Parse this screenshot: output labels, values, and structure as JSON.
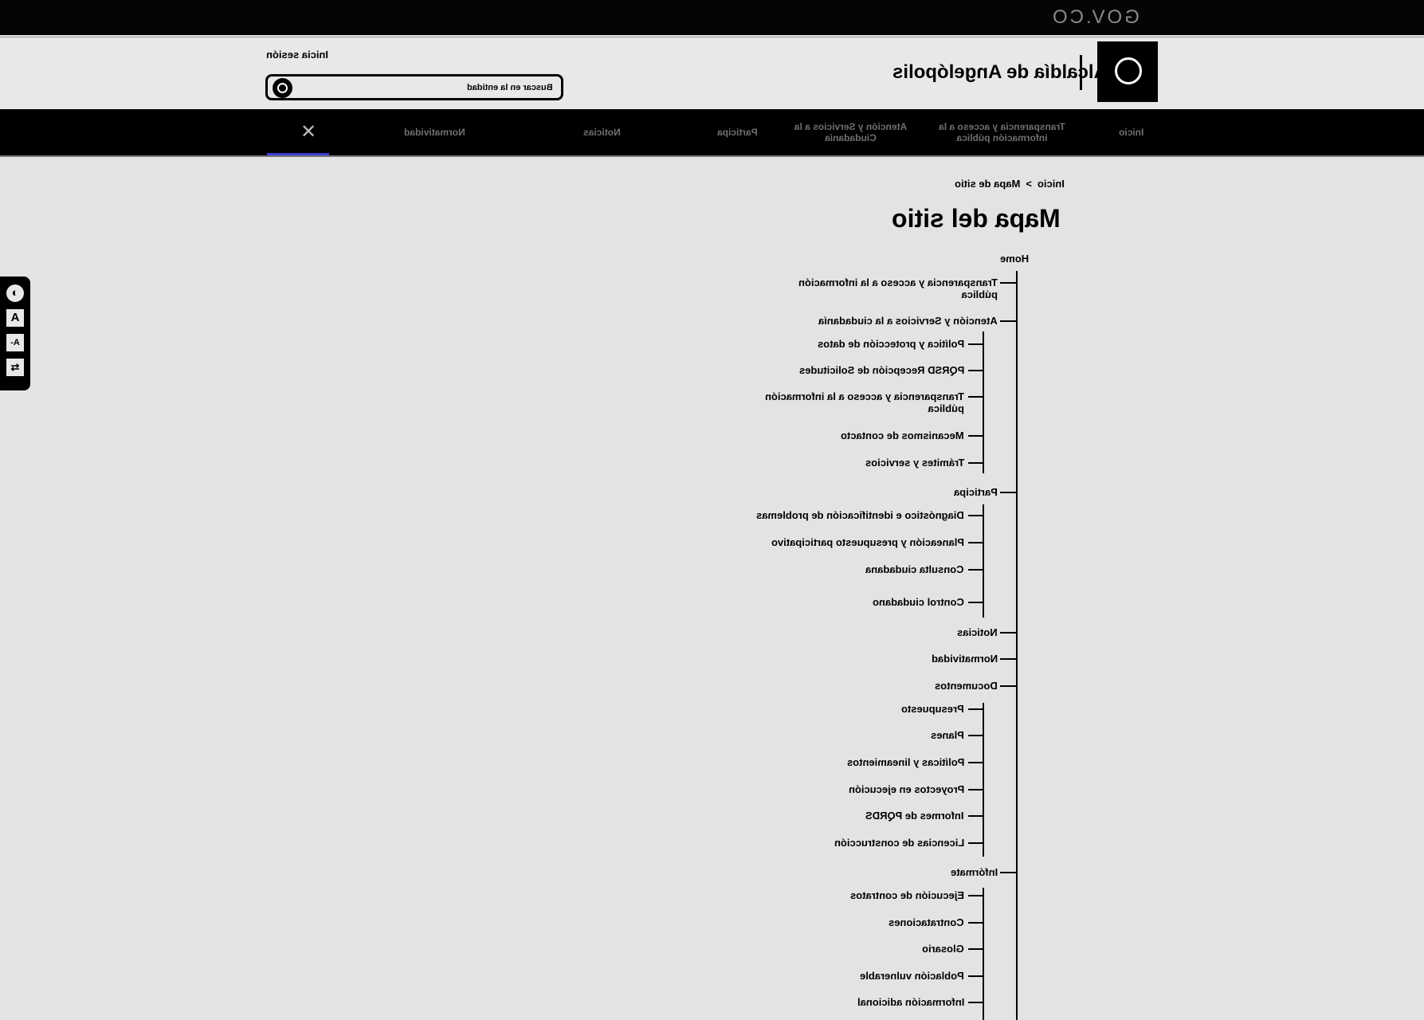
{
  "gov_bar": {
    "logo_text": "GOV.CO"
  },
  "header": {
    "entity_name": "Alcaldía de Angelópolis",
    "login_label": "Inicia sesión",
    "search_placeholder": "Buscar en la entidad"
  },
  "nav": {
    "items": [
      {
        "label": "Inicio"
      },
      {
        "label": "Transparencia y acceso a la información pública"
      },
      {
        "label": "Atención y Servicios a la Ciudadanía"
      },
      {
        "label": "Participa"
      },
      {
        "label": "Noticias"
      },
      {
        "label": "Normatividad"
      }
    ]
  },
  "breadcrumb": {
    "home": "Inicio",
    "separator": ">",
    "current": "Mapa de sitio"
  },
  "page_title": "Mapa del sitio",
  "tree": {
    "root": "Home",
    "sections": [
      {
        "label": "Transparencia y acceso a la información pública",
        "children": []
      },
      {
        "label": "Atención y Servicios a la ciudadanía",
        "children": [
          "Política y protección de datos",
          "PQRSD Recepción de Solicitudes",
          "Transparencia y acceso a la información pública",
          "Mecanismos de contacto",
          "Trámites y servicios"
        ]
      },
      {
        "label": "Participa",
        "children": [
          "Diagnóstico e identificación de problemas",
          "Planeación y presupuesto participativo",
          "Consulta ciudadana",
          "Control ciudadano"
        ]
      },
      {
        "label": "Noticias",
        "children": []
      },
      {
        "label": "Normatividad",
        "children": []
      },
      {
        "label": "Documentos",
        "children": [
          "Presupuesto",
          "Planes",
          "Políticas y lineamientos",
          "Proyectos en ejecución",
          "Informes de PQRDS",
          "Licencias de construcción"
        ]
      },
      {
        "label": "Infórmate",
        "children": [
          "Ejecución de contratos",
          "Contrataciones",
          "Glosario",
          "Población vulnerable",
          "Información adicional"
        ]
      }
    ]
  },
  "accessibility": {
    "buttons": [
      "contrast-icon",
      "increase-font-icon",
      "decrease-font-icon",
      "translate-icon"
    ]
  }
}
